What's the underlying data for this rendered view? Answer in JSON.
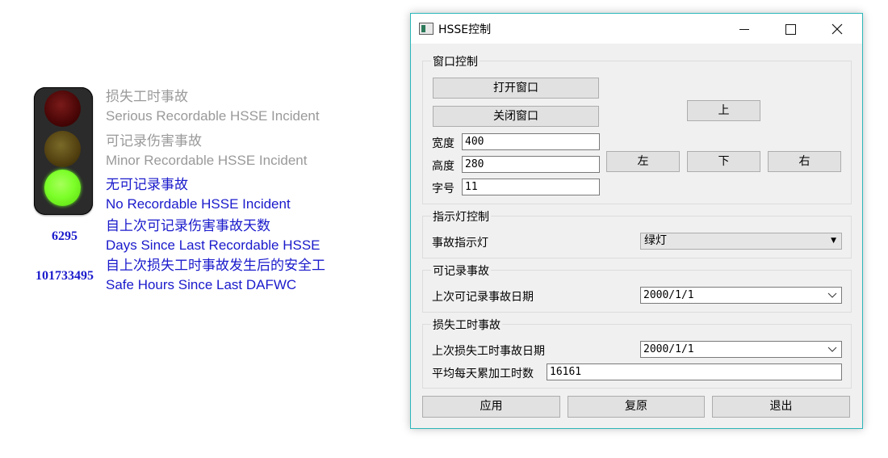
{
  "display": {
    "signal_state": "green",
    "labels": {
      "lost_time_cn": "损失工时事故",
      "lost_time_en": "Serious Recordable HSSE Incident",
      "recordable_cn": "可记录伤害事故",
      "recordable_en": "Minor Recordable HSSE Incident",
      "none_cn": "无可记录事故",
      "none_en": "No Recordable HSSE Incident",
      "days_cn": "自上次可记录伤害事故天数",
      "days_en": "Days Since Last Recordable HSSE",
      "hours_cn": "自上次损失工时事故发生后的安全工",
      "hours_en": "Safe Hours Since Last DAFWC"
    },
    "days_count": "6295",
    "hours_count": "101733495",
    "colors": {
      "active_text": "#1a1acc",
      "inactive_text": "#9a9a9a",
      "green_lamp": "#7dff2a"
    }
  },
  "dialog": {
    "title": "HSSE控制",
    "window_group": {
      "title": "窗口控制",
      "open_button": "打开窗口",
      "close_button": "关闭窗口",
      "width_label": "宽度",
      "width_value": "400",
      "height_label": "高度",
      "height_value": "280",
      "font_label": "字号",
      "font_value": "11",
      "up_button": "上",
      "left_button": "左",
      "down_button": "下",
      "right_button": "右"
    },
    "indicator_group": {
      "title": "指示灯控制",
      "label": "事故指示灯",
      "selected": "绿灯"
    },
    "recordable_group": {
      "title": "可记录事故",
      "label": "上次可记录事故日期",
      "date": "2000/1/1"
    },
    "lost_time_group": {
      "title": "损失工时事故",
      "date_label": "上次损失工时事故日期",
      "date": "2000/1/1",
      "avg_label": "平均每天累加工时数",
      "avg_value": "16161"
    },
    "buttons": {
      "apply": "应用",
      "reset": "复原",
      "exit": "退出"
    }
  }
}
